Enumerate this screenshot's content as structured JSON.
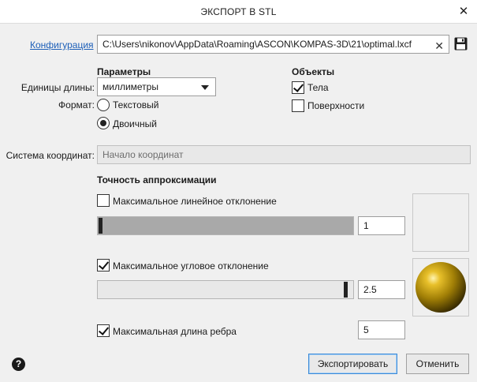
{
  "window": {
    "title": "ЭКСПОРТ В STL",
    "close_glyph": "✕"
  },
  "config": {
    "link_label": "Конфигурация",
    "path_value": "C:\\Users\\nikonov\\AppData\\Roaming\\ASCON\\KOMPAS-3D\\21\\optimal.lxcf",
    "clear_glyph": "✕",
    "save_icon": "floppy-disk-icon"
  },
  "parameters": {
    "heading": "Параметры",
    "units_label": "Единицы длины:",
    "units_value": "миллиметры",
    "format_label": "Формат:",
    "format_options": [
      {
        "label": "Текстовый",
        "selected": false
      },
      {
        "label": "Двоичный",
        "selected": true
      }
    ]
  },
  "objects": {
    "heading": "Объекты",
    "items": [
      {
        "label": "Тела",
        "checked": true
      },
      {
        "label": "Поверхности",
        "checked": false
      }
    ]
  },
  "coordinate_system": {
    "label": "Система координат:",
    "value": "Начало координат"
  },
  "accuracy": {
    "heading": "Точность аппроксимации",
    "linear": {
      "label": "Максимальное линейное отклонение",
      "checked": false,
      "value": "1",
      "slider_fraction": 0.0
    },
    "angular": {
      "label": "Максимальное угловое отклонение",
      "checked": true,
      "value": "2.5",
      "slider_fraction": 1.0
    },
    "edge": {
      "label": "Максимальная длина ребра",
      "checked": true,
      "value": "5"
    }
  },
  "buttons": {
    "export": "Экспортировать",
    "cancel": "Отменить",
    "help": "?"
  },
  "colors": {
    "link": "#1d5fb8",
    "sphere": "#c9a21a",
    "primary_border": "#3c8ad8"
  }
}
